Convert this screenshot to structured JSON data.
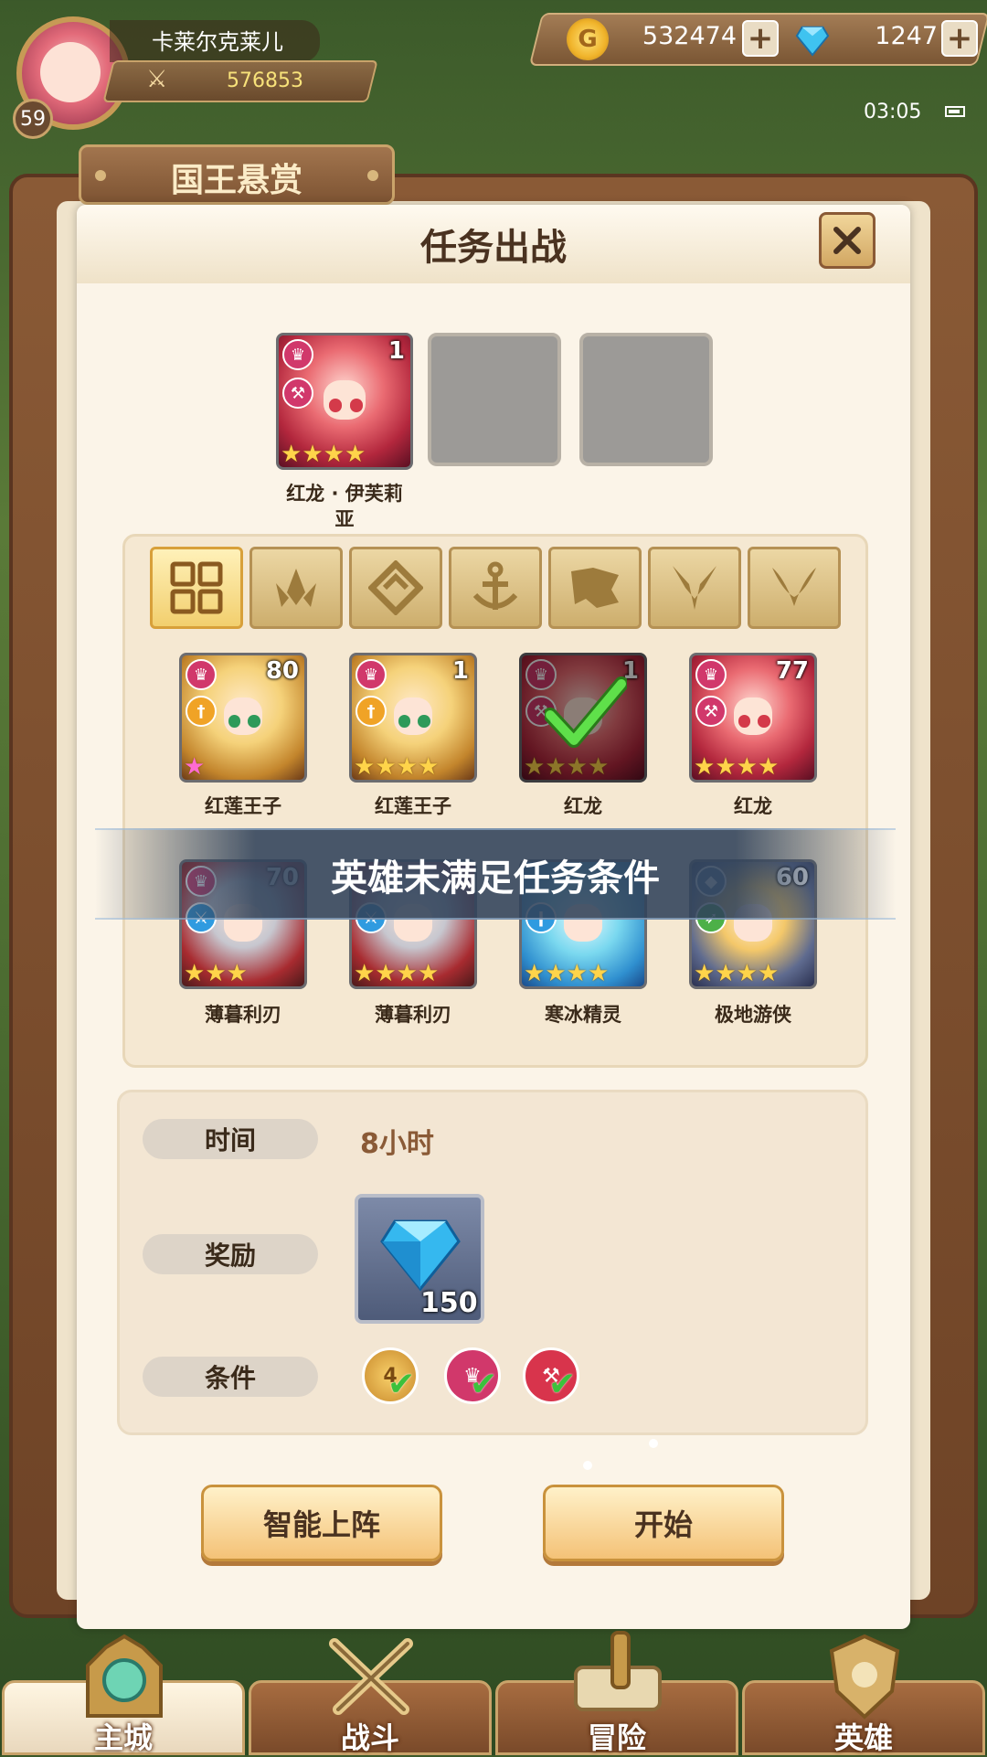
{
  "player": {
    "name": "卡莱尔克莱儿",
    "level": "59",
    "power": "576853"
  },
  "resources": {
    "gold": "532474",
    "gems": "1247",
    "plus": "+"
  },
  "status": {
    "time": "03:05"
  },
  "board": {
    "title": "国王悬赏"
  },
  "dialog": {
    "title": "任务出战",
    "close": "×"
  },
  "selected_slots": [
    {
      "name": "红龙 · 伊芙莉\n亚",
      "number": "1",
      "stars": 4
    }
  ],
  "filter_tabs": [
    "all-icon",
    "forest-icon",
    "diamond-icon",
    "anchor-icon",
    "beast-icon",
    "demon-icon",
    "horn-icon"
  ],
  "heroes": [
    {
      "name": "红莲王子",
      "number": "80",
      "stars": 1,
      "rainbow_star": true
    },
    {
      "name": "红莲王子",
      "number": "1",
      "stars": 4
    },
    {
      "name": "红龙",
      "number": "1",
      "stars": 4,
      "selected": true
    },
    {
      "name": "红龙",
      "number": "77",
      "stars": 4
    },
    {
      "name": "薄暮利刃",
      "number": "70",
      "stars": 3
    },
    {
      "name": "薄暮利刃",
      "number": "",
      "stars": 4
    },
    {
      "name": "寒冰精灵",
      "number": "",
      "stars": 4
    },
    {
      "name": "极地游侠",
      "number": "60",
      "stars": 4
    }
  ],
  "toast": "英雄未满足任务条件",
  "info": {
    "time_label": "时间",
    "time_value": "8小时",
    "reward_label": "奖励",
    "reward_count": "150",
    "condition_label": "条件",
    "condition_star": "4"
  },
  "buttons": {
    "auto": "智能上阵",
    "start": "开始"
  },
  "nav": [
    "主城",
    "战斗",
    "冒险",
    "英雄"
  ],
  "colors": {
    "accent": "#f4c277",
    "toast": "#30425a"
  }
}
